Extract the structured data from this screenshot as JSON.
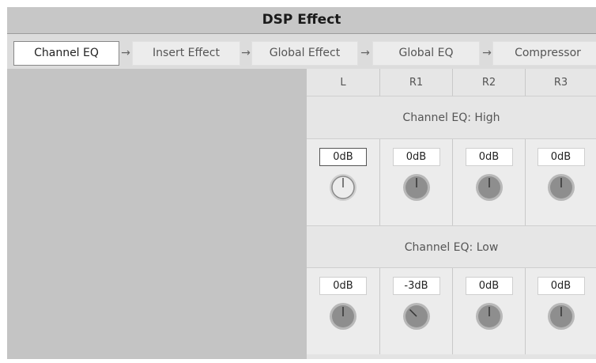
{
  "title": "DSP Effect",
  "tabs": [
    {
      "label": "Channel EQ"
    },
    {
      "label": "Insert Effect"
    },
    {
      "label": "Global Effect"
    },
    {
      "label": "Global EQ"
    },
    {
      "label": "Compressor"
    }
  ],
  "arrow_glyph": "→",
  "columns": [
    "L",
    "R1",
    "R2",
    "R3"
  ],
  "sections": [
    {
      "label": "Channel EQ: High",
      "values": [
        "0dB",
        "0dB",
        "0dB",
        "0dB"
      ]
    },
    {
      "label": "Channel EQ: Low",
      "values": [
        "0dB",
        "-3dB",
        "0dB",
        "0dB"
      ]
    }
  ],
  "colors": {
    "knob_active": "#a9a9a9",
    "knob_inactive": "#8e8e8e",
    "knob_ring": "#b8b8b8"
  }
}
